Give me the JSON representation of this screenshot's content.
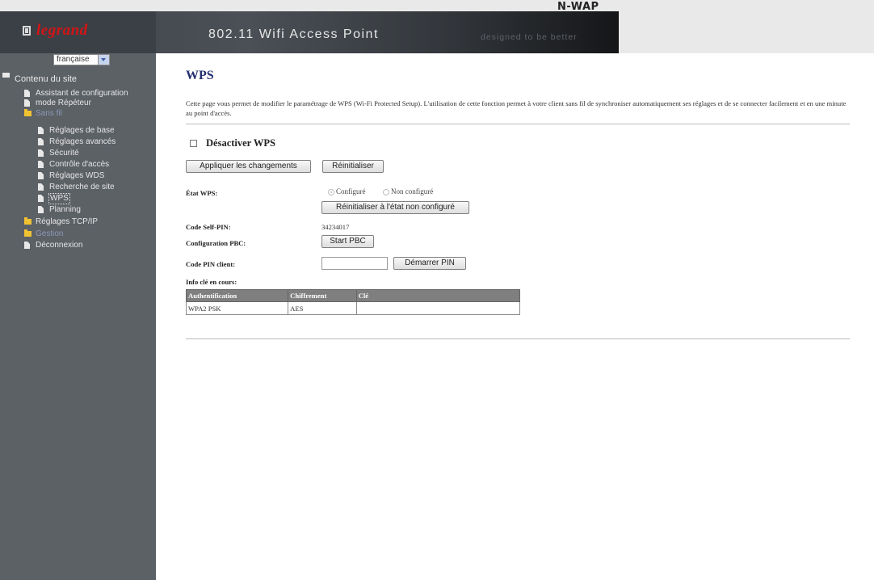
{
  "header": {
    "logo_text": "legrand",
    "product_title": "802.11 Wifi Access Point",
    "brand": "N-WAP",
    "tagline": "designed to be better"
  },
  "sidebar": {
    "language": "française",
    "root_label": "Contenu du site",
    "items": [
      {
        "label": "Assistant de configuration",
        "icon": "doc"
      },
      {
        "label": "mode Répéteur",
        "icon": "doc"
      },
      {
        "label": "Sans fil",
        "icon": "folder"
      },
      {
        "label": "Réglages de base",
        "icon": "doc"
      },
      {
        "label": "Réglages avancés",
        "icon": "doc"
      },
      {
        "label": "Sécurité",
        "icon": "doc"
      },
      {
        "label": "Contrôle d'accès",
        "icon": "doc"
      },
      {
        "label": "Réglages WDS",
        "icon": "doc"
      },
      {
        "label": "Recherche de site",
        "icon": "doc"
      },
      {
        "label": "WPS",
        "icon": "doc"
      },
      {
        "label": "Planning",
        "icon": "doc"
      },
      {
        "label": "Réglages TCP/IP",
        "icon": "folder"
      },
      {
        "label": "Gestion",
        "icon": "folder"
      },
      {
        "label": "Déconnexion",
        "icon": "doc"
      }
    ]
  },
  "main": {
    "title": "WPS",
    "description": "Cette page vous permet de modifier le paramétrage de WPS (Wi-Fi Protected Setup). L'utilisation de cette fonction permet à votre client sans fil de synchroniser automatiquement ses réglages et de se connecter facilement et en une minute au point d'accès.",
    "disable_label": "Désactiver WPS",
    "disable_checked": false,
    "apply_button": "Appliquer les changements",
    "reset_button": "Réinitialiser",
    "state_label": "État WPS:",
    "state_options": [
      "Configuré",
      "Non configuré"
    ],
    "state_selected": "Configuré",
    "reset_unconfigured_button": "Réinitialiser à l'état non configuré",
    "self_pin_label": "Code Self-PIN:",
    "self_pin_value": "34234017",
    "pbc_label": "Configuration PBC:",
    "pbc_button": "Start PBC",
    "client_pin_label": "Code PIN client:",
    "client_pin_value": "",
    "start_pin_button": "Démarrer PIN",
    "key_info_label": "Info clé en cours:",
    "key_table": {
      "headers": [
        "Authentification",
        "Chiffrement",
        "Clé"
      ],
      "rows": [
        [
          "WPA2 PSK",
          "AES",
          ""
        ]
      ]
    }
  },
  "colors": {
    "sidebar_bg": "#5c6166",
    "title_color": "#222e6f",
    "logo_red": "#d41414",
    "table_header_bg": "#7f7f7f"
  }
}
